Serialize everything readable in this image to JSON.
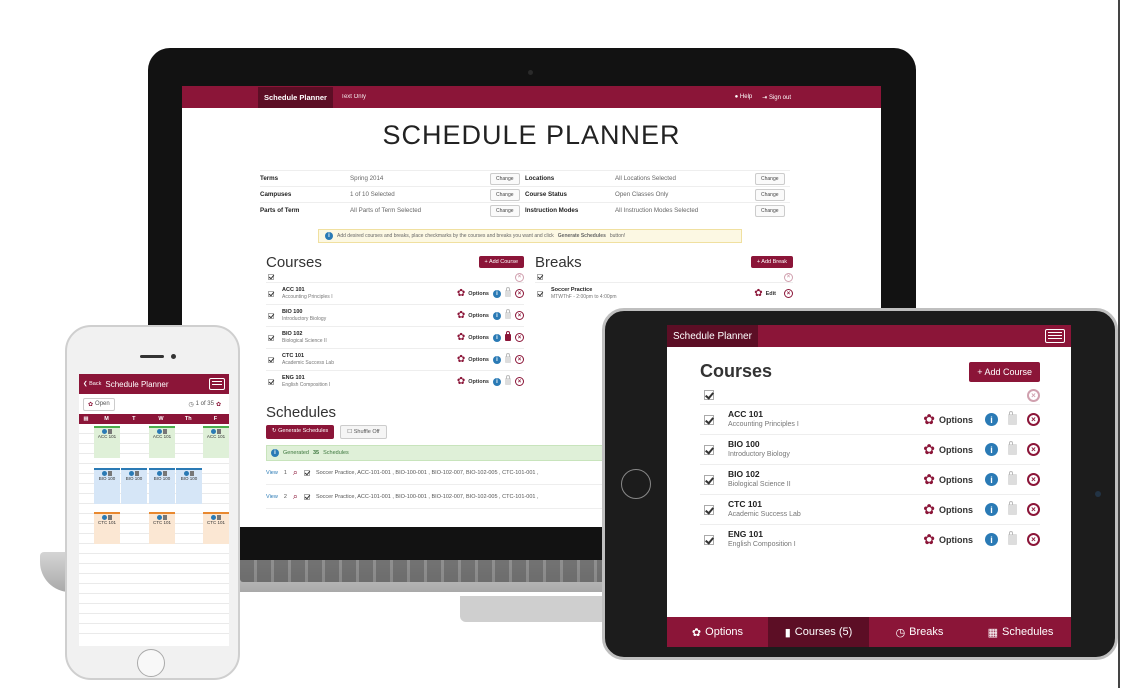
{
  "laptop": {
    "nav": {
      "brand": "Schedule Planner",
      "text_only": "Text Only",
      "help": "Help",
      "sign_out": "Sign out"
    },
    "title": "SCHEDULE PLANNER",
    "settings": [
      {
        "label": "Terms",
        "value": "Spring 2014",
        "button": "Change"
      },
      {
        "label": "Locations",
        "value": "All Locations Selected",
        "button": "Change"
      },
      {
        "label": "Campuses",
        "value": "1 of 10 Selected",
        "button": "Change"
      },
      {
        "label": "Course Status",
        "value": "Open Classes Only",
        "button": "Change"
      },
      {
        "label": "Parts of Term",
        "value": "All Parts of Term Selected",
        "button": "Change"
      },
      {
        "label": "Instruction Modes",
        "value": "All Instruction Modes Selected",
        "button": "Change"
      }
    ],
    "alert": {
      "text": "Add desired courses and breaks, place checkmarks by the courses and breaks you want and click",
      "bold": "Generate Schedules",
      "suffix": "button!"
    },
    "courses_heading": "Courses",
    "add_course": "+ Add Course",
    "options_label": "Options",
    "courses": [
      {
        "code": "ACC 101",
        "name": "Accounting Principles I",
        "locked": false
      },
      {
        "code": "BIO 100",
        "name": "Introductory Biology",
        "locked": false
      },
      {
        "code": "BIO 102",
        "name": "Biological Science II",
        "locked": true
      },
      {
        "code": "CTC 101",
        "name": "Academic Success Lab",
        "locked": false
      },
      {
        "code": "ENG 101",
        "name": "English Composition I",
        "locked": false
      }
    ],
    "breaks_heading": "Breaks",
    "add_break": "+ Add Break",
    "break_item": {
      "name": "Soccer Practice",
      "time": "MTWThF - 2:00pm to 4:00pm",
      "edit": "Edit"
    },
    "schedules_heading": "Schedules",
    "generate_button": "Generate Schedules",
    "shuffle_button": "Shuffle Off",
    "generated": {
      "prefix": "Generated",
      "count": "35",
      "suffix": "Schedules"
    },
    "schedule_rows": [
      {
        "view": "View",
        "num": "1",
        "text": "Soccer Practice, ACC-101-001 , BIO-100-001 , BIO-102-007, BIO-102-005 , CTC-101-001 ,"
      },
      {
        "view": "View",
        "num": "2",
        "text": "Soccer Practice, ACC-101-001 , BIO-100-001 , BIO-102-007, BIO-102-005 , CTC-101-001 ,"
      }
    ]
  },
  "phone": {
    "back": "Back",
    "title": "Schedule Planner",
    "open": "Open",
    "pager": "1 of 35",
    "days": [
      "M",
      "T",
      "W",
      "Th",
      "F"
    ],
    "block_labels": {
      "acc": "ACC 101",
      "bio": "BIO 100",
      "ctc": "CTC 101"
    }
  },
  "tablet": {
    "brand": "Schedule Planner",
    "heading": "Courses",
    "add_course": "+ Add Course",
    "options_label": "Options",
    "courses": [
      {
        "code": "ACC 101",
        "name": "Accounting Principles I"
      },
      {
        "code": "BIO 100",
        "name": "Introductory Biology"
      },
      {
        "code": "BIO 102",
        "name": "Biological Science II"
      },
      {
        "code": "CTC 101",
        "name": "Academic Success Lab"
      },
      {
        "code": "ENG 101",
        "name": "English Composition I"
      }
    ],
    "tabs": [
      {
        "icon": "gear-icon",
        "label": "Options"
      },
      {
        "icon": "book-icon",
        "label": "Courses (5)",
        "active": true
      },
      {
        "icon": "clock-icon",
        "label": "Breaks"
      },
      {
        "icon": "calendar-icon",
        "label": "Schedules"
      }
    ]
  },
  "colors": {
    "brand": "#8b1538",
    "brand_dark": "#5c0e25",
    "info": "#2a7ab5",
    "success_bg": "#dff0d8"
  }
}
